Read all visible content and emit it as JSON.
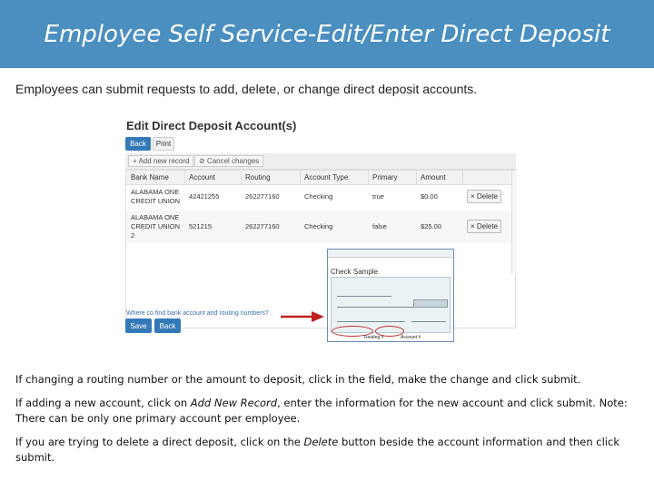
{
  "header": {
    "title": "Employee Self Service-Edit/Enter Direct Deposit"
  },
  "intro": "Employees can submit requests to add, delete, or change direct deposit accounts.",
  "screenshot": {
    "title": "Edit Direct Deposit Account(s)",
    "back_label": "Back",
    "print_label": "Print",
    "add_record_label": "+ Add new record",
    "cancel_changes_label": "⊘ Cancel changes",
    "columns": [
      "Bank Name",
      "Account",
      "Routing",
      "Account Type",
      "Primary",
      "Amount"
    ],
    "rows": [
      {
        "bank": "ALABAMA ONE CREDIT UNION",
        "account": "42421255",
        "routing": "262277160",
        "type": "Checking",
        "primary": "true",
        "amount": "$0.00",
        "delete": "× Delete"
      },
      {
        "bank": "ALABAMA ONE CREDIT UNION 2",
        "account": "521215",
        "routing": "262277160",
        "type": "Checking",
        "primary": "false",
        "amount": "$25.00",
        "delete": "× Delete"
      }
    ],
    "help_link": "Where co   find bank account and routing numbers?",
    "save_label": "Save",
    "back2_label": "Back",
    "check_sample": {
      "title": "Check Sample",
      "routing_label": "Routing #",
      "account_label": "Account #"
    },
    "accent_color": "#3479b7"
  },
  "instructions": {
    "p1": "If changing a routing number or the amount to deposit, click in the field, make the change and click submit.",
    "p2_a": "If adding a new account, click on ",
    "p2_em": "Add New Record",
    "p2_b": ", enter the information for the new account and click submit.  Note: There can be only one primary account per employee.",
    "p3_a": "If you are trying to delete a direct deposit, click on the ",
    "p3_em": "Delete",
    "p3_b": " button beside the account information and then click submit."
  }
}
